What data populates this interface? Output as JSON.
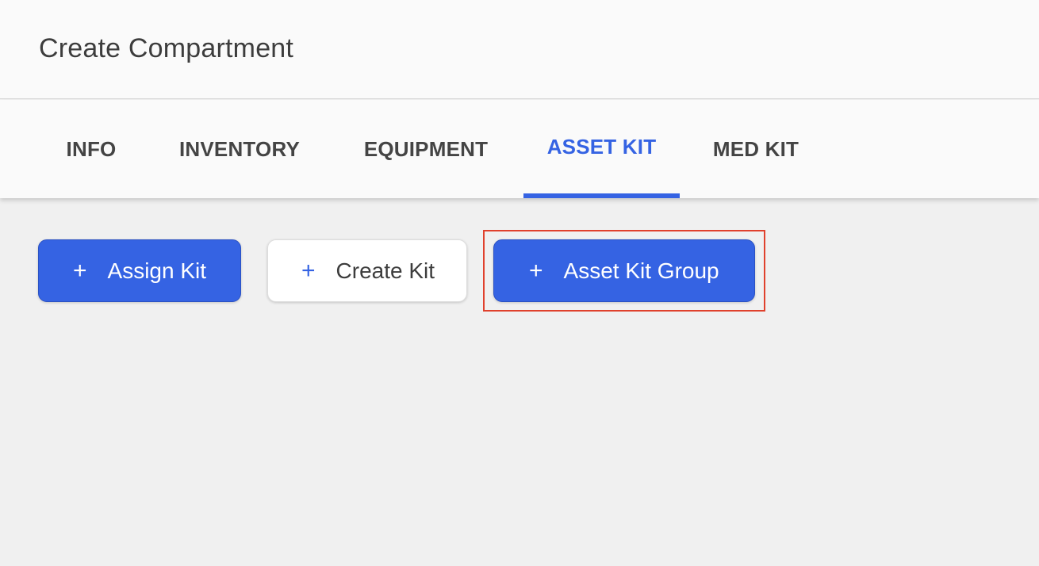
{
  "header": {
    "title": "Create Compartment"
  },
  "tabs": [
    {
      "label": "INFO",
      "active": false
    },
    {
      "label": "INVENTORY",
      "active": false
    },
    {
      "label": "EQUIPMENT",
      "active": false
    },
    {
      "label": "ASSET KIT",
      "active": true
    },
    {
      "label": "MED KIT",
      "active": false
    }
  ],
  "actions": {
    "assign_kit": {
      "icon": "+",
      "label": "Assign Kit"
    },
    "create_kit": {
      "icon": "+",
      "label": "Create Kit"
    },
    "asset_kit_group": {
      "icon": "+",
      "label": "Asset Kit Group"
    }
  },
  "colors": {
    "accent": "#3563e3",
    "highlight": "#e0412d",
    "background": "#f0f0f0"
  },
  "icons": {
    "add": "plus-icon"
  }
}
